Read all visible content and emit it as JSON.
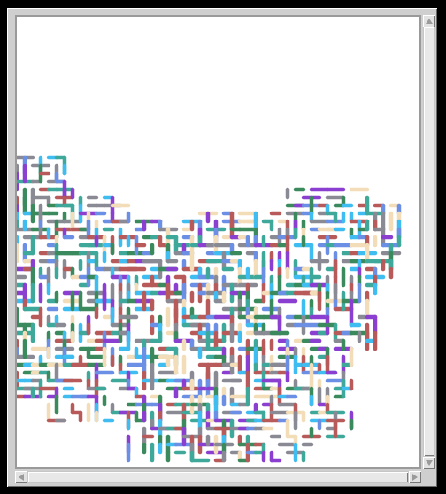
{
  "colors": [
    "#b85a5a",
    "#3ea89a",
    "#8a3fd0",
    "#3fbcf0",
    "#f2ddb8",
    "#3a8a5e",
    "#6c8fe6",
    "#8a8a94"
  ],
  "canvas": {
    "background": "#ffffff"
  },
  "icons": {
    "scroll_up": "triangle-up",
    "scroll_down": "triangle-down",
    "scroll_left": "triangle-left",
    "scroll_right": "triangle-right"
  }
}
